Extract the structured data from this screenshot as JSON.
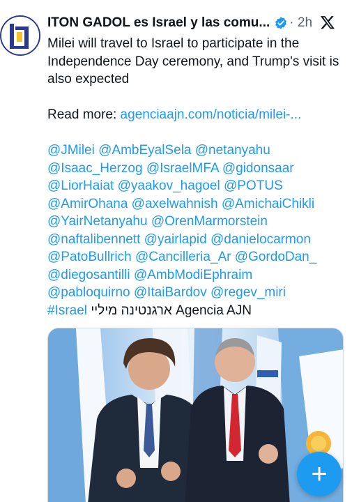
{
  "author": {
    "name": "ITON GADOL es Israel y las comu...",
    "time": "2h",
    "verified_icon": "verified-badge-icon"
  },
  "post": {
    "line1": "Milei will travel to Israel to participate in the Independence Day ceremony, and Trump's visit is also expected",
    "read_more_label": "Read more: ",
    "read_more_link": "agenciaajn.com/noticia/milei-...",
    "mentions": [
      "@JMilei",
      "@AmbEyalSela",
      "@netanyahu",
      "@Isaac_Herzog",
      "@IsraelMFA",
      "@gidonsaar",
      "@LiorHaiat",
      "@yaakov_hagoel",
      "@POTUS",
      "@AmirOhana",
      "@axelwahnish",
      "@AmichaiChikli",
      "@YairNetanyahu",
      "@OrenMarmorstein",
      "@naftalibennett",
      "@yairlapid",
      "@danielocarmon",
      "@PatoBullrich",
      "@Cancilleria_Ar",
      "@GordoDan_",
      "@diegosantilli",
      "@AmbModiEphraim",
      "@pabloquirno",
      "@ItaiBardov",
      "@regev_miri"
    ],
    "hashtag": "#Israel",
    "hebrew_text": "ארגנטינה מיליי",
    "agency": "Agencia AJN"
  },
  "compose_button_label": "+",
  "colors": {
    "accent": "#1d9bf0",
    "text": "#0f1419",
    "secondary": "#536471"
  }
}
